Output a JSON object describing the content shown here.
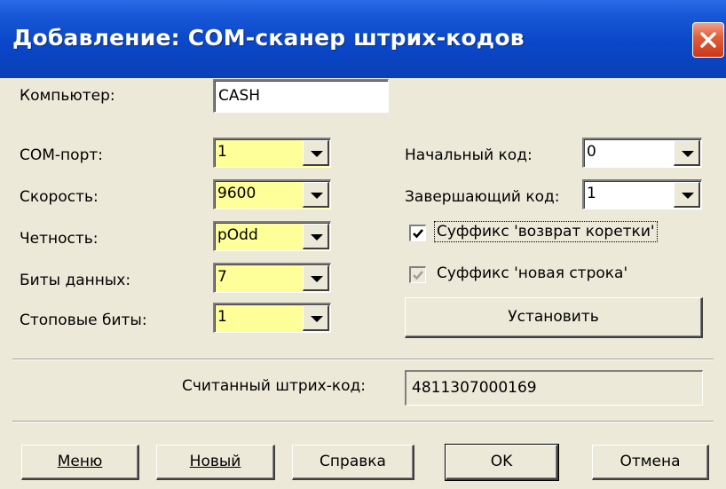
{
  "window": {
    "title": "Добавление: COM-сканер штрих-кодов",
    "close_icon": "close-icon"
  },
  "form": {
    "computer_label": "Компьютер:",
    "computer_value": "CASH",
    "com_port_label": "COM-порт:",
    "com_port_value": "1",
    "speed_label": "Скорость:",
    "speed_value": "9600",
    "parity_label": "Четность:",
    "parity_value": "pOdd",
    "data_bits_label": "Биты данных:",
    "data_bits_value": "7",
    "stop_bits_label": "Стоповые биты:",
    "stop_bits_value": "1",
    "start_code_label": "Начальный код:",
    "start_code_value": "0",
    "end_code_label": "Завершающий код:",
    "end_code_value": "1",
    "suffix_cr_label": "Суффикс 'возврат коретки'",
    "suffix_cr_checked": true,
    "suffix_lf_label": "Суффикс 'новая строка'",
    "suffix_lf_checked": true,
    "suffix_lf_disabled": true,
    "install_button": "Установить",
    "scanned_label": "Считанный штрих-код:",
    "scanned_value": "4811307000169"
  },
  "footer": {
    "menu_button": "Меню",
    "new_button": "Новый",
    "help_button": "Справка",
    "ok_button": "OK",
    "cancel_button": "Отмена"
  },
  "colors": {
    "titlebar": "#0a47c9",
    "dialog_bg": "#ece9d8",
    "combo_highlight": "#ffff99",
    "close_button": "#e3603c"
  }
}
